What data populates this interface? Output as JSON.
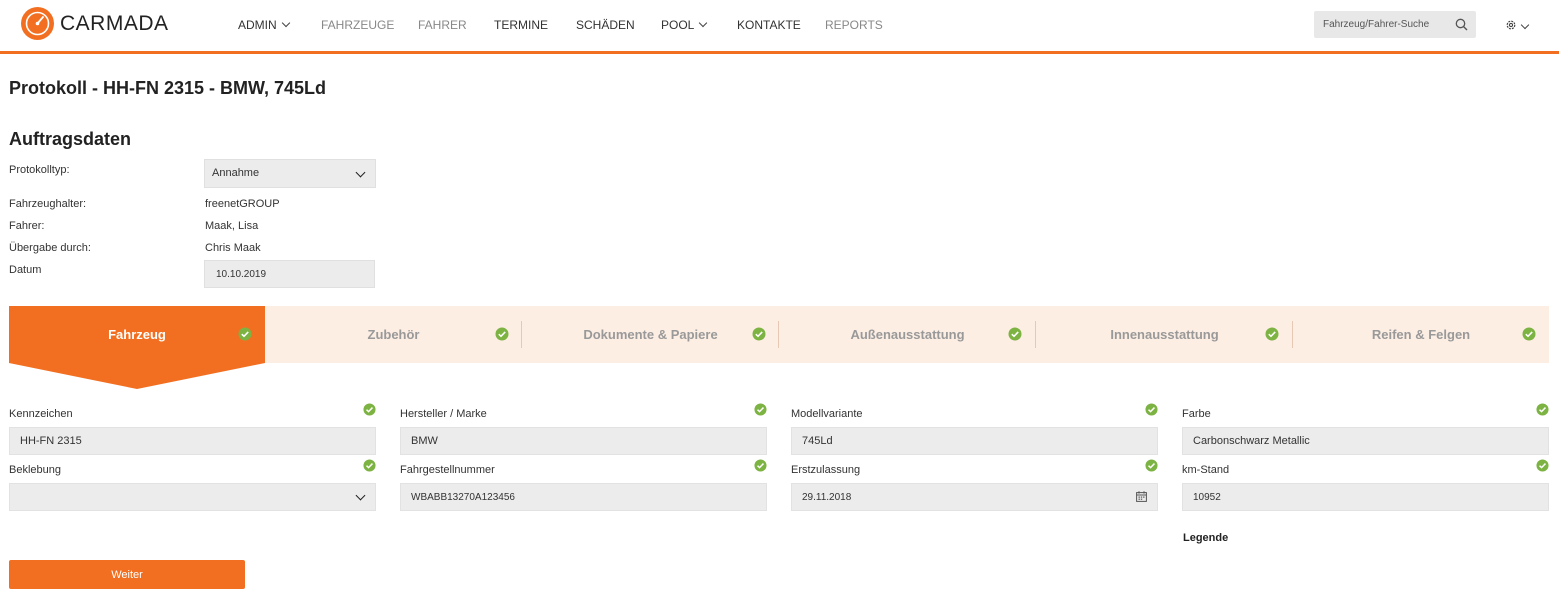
{
  "header": {
    "brand": "CARMADA",
    "nav": [
      {
        "label": "ADMIN",
        "dropdown": true,
        "muted": false
      },
      {
        "label": "FAHRZEUGE",
        "dropdown": false,
        "muted": true
      },
      {
        "label": "FAHRER",
        "dropdown": false,
        "muted": true
      },
      {
        "label": "TERMINE",
        "dropdown": false,
        "muted": false
      },
      {
        "label": "SCHÄDEN",
        "dropdown": false,
        "muted": false
      },
      {
        "label": "POOL",
        "dropdown": true,
        "muted": false
      },
      {
        "label": "KONTAKTE",
        "dropdown": false,
        "muted": false
      },
      {
        "label": "REPORTS",
        "dropdown": false,
        "muted": true
      }
    ],
    "search_placeholder": "Fahrzeug/Fahrer-Suche",
    "settings_icon": "gear-icon"
  },
  "page": {
    "title": "Protokoll - HH-FN 2315 - BMW, 745Ld",
    "section_title": "Auftragsdaten"
  },
  "order": {
    "protokolltyp_label": "Protokolltyp:",
    "protokolltyp_value": "Annahme",
    "halter_label": "Fahrzeughalter:",
    "halter_value": "freenetGROUP",
    "fahrer_label": "Fahrer:",
    "fahrer_value": "Maak, Lisa",
    "uebergabe_label": "Übergabe durch:",
    "uebergabe_value": "Chris Maak",
    "datum_label": "Datum",
    "datum_value": "10.10.2019"
  },
  "tabs": [
    {
      "label": "Fahrzeug",
      "active": true,
      "complete": true
    },
    {
      "label": "Zubehör",
      "active": false,
      "complete": true
    },
    {
      "label": "Dokumente & Papiere",
      "active": false,
      "complete": true
    },
    {
      "label": "Außenausstattung",
      "active": false,
      "complete": true
    },
    {
      "label": "Innenausstattung",
      "active": false,
      "complete": true
    },
    {
      "label": "Reifen & Felgen",
      "active": false,
      "complete": true
    }
  ],
  "fields": {
    "kennzeichen": {
      "label": "Kennzeichen",
      "value": "HH-FN 2315"
    },
    "hersteller": {
      "label": "Hersteller / Marke",
      "value": "BMW"
    },
    "modell": {
      "label": "Modellvariante",
      "value": "745Ld"
    },
    "farbe": {
      "label": "Farbe",
      "value": "Carbonschwarz Metallic"
    },
    "beklebung": {
      "label": "Beklebung",
      "value": ""
    },
    "fin": {
      "label": "Fahrgestellnummer",
      "value": "WBABB13270A123456"
    },
    "erstzulassung": {
      "label": "Erstzulassung",
      "value": "29.11.2018"
    },
    "km": {
      "label": "km-Stand",
      "value": "10952"
    }
  },
  "legend": "Legende",
  "next_button": "Weiter",
  "colors": {
    "accent": "#f26f21",
    "tab_bg": "#fdeee4",
    "check": "#7cb342"
  }
}
